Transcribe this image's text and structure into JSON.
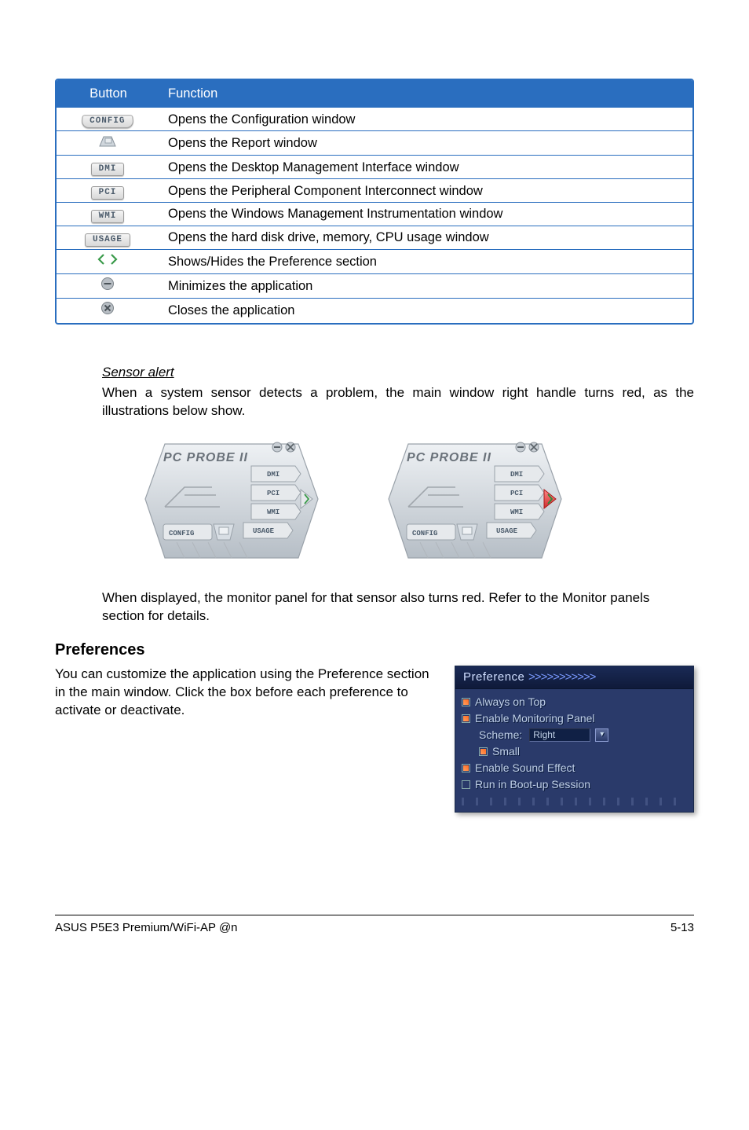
{
  "table": {
    "head_button": "Button",
    "head_function": "Function",
    "rows": [
      {
        "btn": "CONFIG",
        "func": "Opens the Configuration window"
      },
      {
        "btn": "report",
        "func": "Opens the Report window"
      },
      {
        "btn": "DMI",
        "func": "Opens the Desktop Management Interface window"
      },
      {
        "btn": "PCI",
        "func": "Opens the Peripheral Component Interconnect window"
      },
      {
        "btn": "WMI",
        "func": "Opens the Windows Management Instrumentation window"
      },
      {
        "btn": "USAGE",
        "func": "Opens the hard disk drive, memory, CPU usage window"
      },
      {
        "btn": "arrows",
        "func": "Shows/Hides the Preference section"
      },
      {
        "btn": "min",
        "func": "Minimizes the application"
      },
      {
        "btn": "close",
        "func": "Closes the application"
      }
    ]
  },
  "sensor": {
    "heading": "Sensor alert",
    "para": "When a system sensor detects a problem, the main window right handle turns red, as the illustrations below show.",
    "after": "When displayed, the monitor panel for that sensor also turns red. Refer to the Monitor panels section for details."
  },
  "probe": {
    "title": "PC PROBE II",
    "b1": "DMI",
    "b2": "PCI",
    "b3": "WMI",
    "b4": "USAGE",
    "b5": "CONFIG"
  },
  "pref": {
    "heading": "Preferences",
    "para": "You can customize the application using the Preference section in the main window. Click the box before each preference to activate or deactivate.",
    "panel_title": "Preference ",
    "chevrons": ">>>>>>>>>>>",
    "always_on_top": "Always on Top",
    "enable_monitoring": "Enable Monitoring Panel",
    "scheme_label": "Scheme:",
    "scheme_value": "Right",
    "small": "Small",
    "enable_sound": "Enable Sound Effect",
    "run_boot": "Run in Boot-up Session"
  },
  "footer": {
    "left": "ASUS P5E3 Premium/WiFi-AP @n",
    "right": "5-13"
  }
}
